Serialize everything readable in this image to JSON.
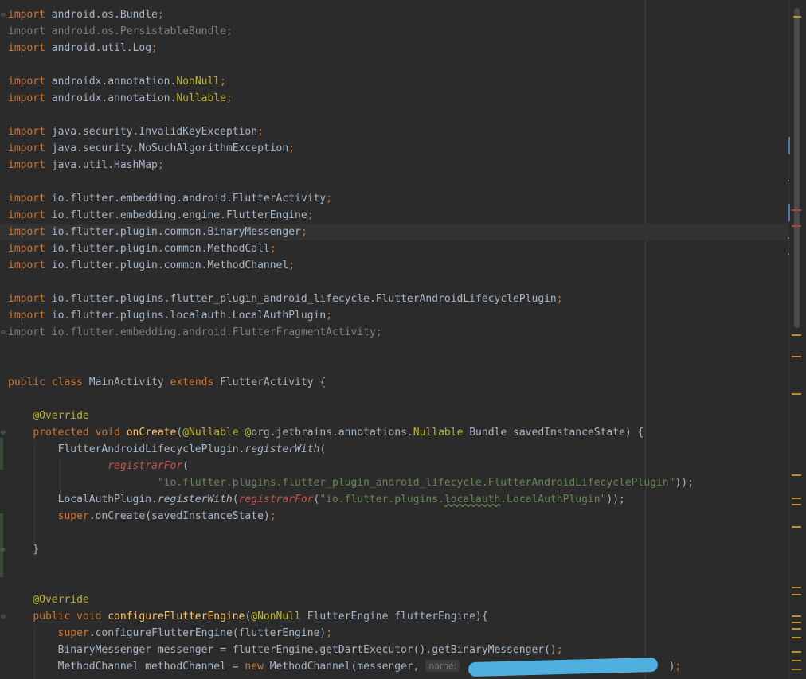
{
  "editor": {
    "lines": [
      {
        "tokens": [
          [
            "kw",
            "import"
          ],
          [
            "plain",
            " android.os.Bundle"
          ],
          [
            "kw",
            ";"
          ]
        ]
      },
      {
        "tokens": [
          [
            "gray",
            "import android.os.PersistableBundle;"
          ]
        ]
      },
      {
        "tokens": [
          [
            "kw",
            "import"
          ],
          [
            "plain",
            " android.util.Log"
          ],
          [
            "kw",
            ";"
          ]
        ]
      },
      {
        "tokens": []
      },
      {
        "tokens": [
          [
            "kw",
            "import"
          ],
          [
            "plain",
            " androidx.annotation."
          ],
          [
            "ann",
            "NonNull"
          ],
          [
            "kw",
            ";"
          ]
        ]
      },
      {
        "tokens": [
          [
            "kw",
            "import"
          ],
          [
            "plain",
            " androidx.annotation."
          ],
          [
            "ann",
            "Nullable"
          ],
          [
            "kw",
            ";"
          ]
        ]
      },
      {
        "tokens": []
      },
      {
        "tokens": [
          [
            "kw",
            "import"
          ],
          [
            "plain",
            " java.security.InvalidKeyException"
          ],
          [
            "kw",
            ";"
          ]
        ]
      },
      {
        "tokens": [
          [
            "kw",
            "import"
          ],
          [
            "plain",
            " java.security.NoSuchAlgorithmException"
          ],
          [
            "kw",
            ";"
          ]
        ]
      },
      {
        "tokens": [
          [
            "kw",
            "import"
          ],
          [
            "plain",
            " java.util.HashMap"
          ],
          [
            "kw",
            ";"
          ]
        ]
      },
      {
        "tokens": []
      },
      {
        "tokens": [
          [
            "kw",
            "import"
          ],
          [
            "plain",
            " io.flutter.embedding.android.FlutterActivity"
          ],
          [
            "kw",
            ";"
          ]
        ]
      },
      {
        "tokens": [
          [
            "kw",
            "import"
          ],
          [
            "plain",
            " io.flutter.embedding.engine.FlutterEngine"
          ],
          [
            "kw",
            ";"
          ]
        ]
      },
      {
        "tokens": [
          [
            "kw",
            "import"
          ],
          [
            "plain",
            " io.flutter.plugin.common.BinaryMessenger"
          ],
          [
            "kw",
            ";"
          ]
        ],
        "current": true
      },
      {
        "tokens": [
          [
            "kw",
            "import"
          ],
          [
            "plain",
            " io.flutter.plugin.common.MethodCall"
          ],
          [
            "kw",
            ";"
          ]
        ]
      },
      {
        "tokens": [
          [
            "kw",
            "import"
          ],
          [
            "plain",
            " io.flutter.plugin.common.MethodChannel"
          ],
          [
            "kw",
            ";"
          ]
        ]
      },
      {
        "tokens": []
      },
      {
        "tokens": [
          [
            "kw",
            "import"
          ],
          [
            "plain",
            " io.flutter.plugins.flutter_plugin_android_lifecycle.FlutterAndroidLifecyclePlugin"
          ],
          [
            "kw",
            ";"
          ]
        ]
      },
      {
        "tokens": [
          [
            "kw",
            "import"
          ],
          [
            "plain",
            " io.flutter.plugins.localauth.LocalAuthPlugin"
          ],
          [
            "kw",
            ";"
          ]
        ]
      },
      {
        "tokens": [
          [
            "gray",
            "import io.flutter.embedding.android.FlutterFragmentActivity;"
          ]
        ]
      },
      {
        "tokens": []
      },
      {
        "tokens": []
      },
      {
        "tokens": [
          [
            "kw",
            "public class"
          ],
          [
            "plain",
            " MainActivity "
          ],
          [
            "kw",
            "extends"
          ],
          [
            "plain",
            " FlutterActivity {"
          ]
        ]
      },
      {
        "tokens": []
      },
      {
        "tokens": [
          [
            "plain",
            "    "
          ],
          [
            "ann",
            "@Override"
          ]
        ]
      },
      {
        "tokens": [
          [
            "plain",
            "    "
          ],
          [
            "kw",
            "protected void "
          ],
          [
            "fn",
            "onCreate"
          ],
          [
            "plain",
            "("
          ],
          [
            "ann",
            "@Nullable "
          ],
          [
            "ann",
            "@"
          ],
          [
            "plain",
            "org.jetbrains.annotations."
          ],
          [
            "ann",
            "Nullable"
          ],
          [
            "plain",
            " Bundle savedInstanceState) {"
          ]
        ]
      },
      {
        "tokens": [
          [
            "plain",
            "        FlutterAndroidLifecyclePlugin."
          ],
          [
            "italic",
            "registerWith"
          ],
          [
            "plain",
            "("
          ]
        ]
      },
      {
        "tokens": [
          [
            "plain",
            "                "
          ],
          [
            "red",
            "registrarFor"
          ],
          [
            "plain",
            "("
          ]
        ]
      },
      {
        "tokens": [
          [
            "plain",
            "                        "
          ],
          [
            "str",
            "\"io.flutter.plugins.flutter_plugin_android_lifecycle.FlutterAndroidLifecyclePlugin\""
          ],
          [
            "plain",
            "));"
          ]
        ]
      },
      {
        "tokens": [
          [
            "plain",
            "        LocalAuthPlugin."
          ],
          [
            "italic",
            "registerWith"
          ],
          [
            "plain",
            "("
          ],
          [
            "red",
            "registrarFor"
          ],
          [
            "plain",
            "("
          ],
          [
            "str",
            "\"io.flutter.plugins."
          ],
          [
            "strsq",
            "localauth"
          ],
          [
            "str",
            ".LocalAuthPlugin\""
          ],
          [
            "plain",
            "));"
          ]
        ]
      },
      {
        "tokens": [
          [
            "plain",
            "        "
          ],
          [
            "kw",
            "super"
          ],
          [
            "plain",
            ".onCreate(savedInstanceState)"
          ],
          [
            "kw",
            ";"
          ]
        ]
      },
      {
        "tokens": []
      },
      {
        "tokens": [
          [
            "plain",
            "    }"
          ]
        ]
      },
      {
        "tokens": []
      },
      {
        "tokens": []
      },
      {
        "tokens": [
          [
            "plain",
            "    "
          ],
          [
            "ann",
            "@Override"
          ]
        ]
      },
      {
        "tokens": [
          [
            "plain",
            "    "
          ],
          [
            "kw",
            "public void "
          ],
          [
            "fn",
            "configureFlutterEngine"
          ],
          [
            "plain",
            "("
          ],
          [
            "ann",
            "@NonNull"
          ],
          [
            "plain",
            " FlutterEngine flutterEngine){"
          ]
        ]
      },
      {
        "tokens": [
          [
            "plain",
            "        "
          ],
          [
            "kw",
            "super"
          ],
          [
            "plain",
            ".configureFlutterEngine(flutterEngine)"
          ],
          [
            "kw",
            ";"
          ]
        ]
      },
      {
        "tokens": [
          [
            "plain",
            "        BinaryMessenger messenger = flutterEngine.getDartExecutor().getBinaryMessenger()"
          ],
          [
            "kw",
            ";"
          ]
        ]
      },
      {
        "tokens": [
          [
            "plain",
            "        MethodChannel methodChannel = "
          ],
          [
            "kw",
            "new"
          ],
          [
            "plain",
            " MethodChannel(messenger, "
          ],
          [
            "hint",
            "name:"
          ],
          [
            "plain",
            "                                 )"
          ],
          [
            "kw",
            ";"
          ]
        ]
      }
    ]
  },
  "colors": {
    "background": "#2b2b2b",
    "keyword": "#cc7832",
    "annotation": "#bbb529",
    "string": "#6a8759",
    "method": "#ffc66d",
    "error": "#c75450",
    "redaction": "#4fb0e0"
  }
}
